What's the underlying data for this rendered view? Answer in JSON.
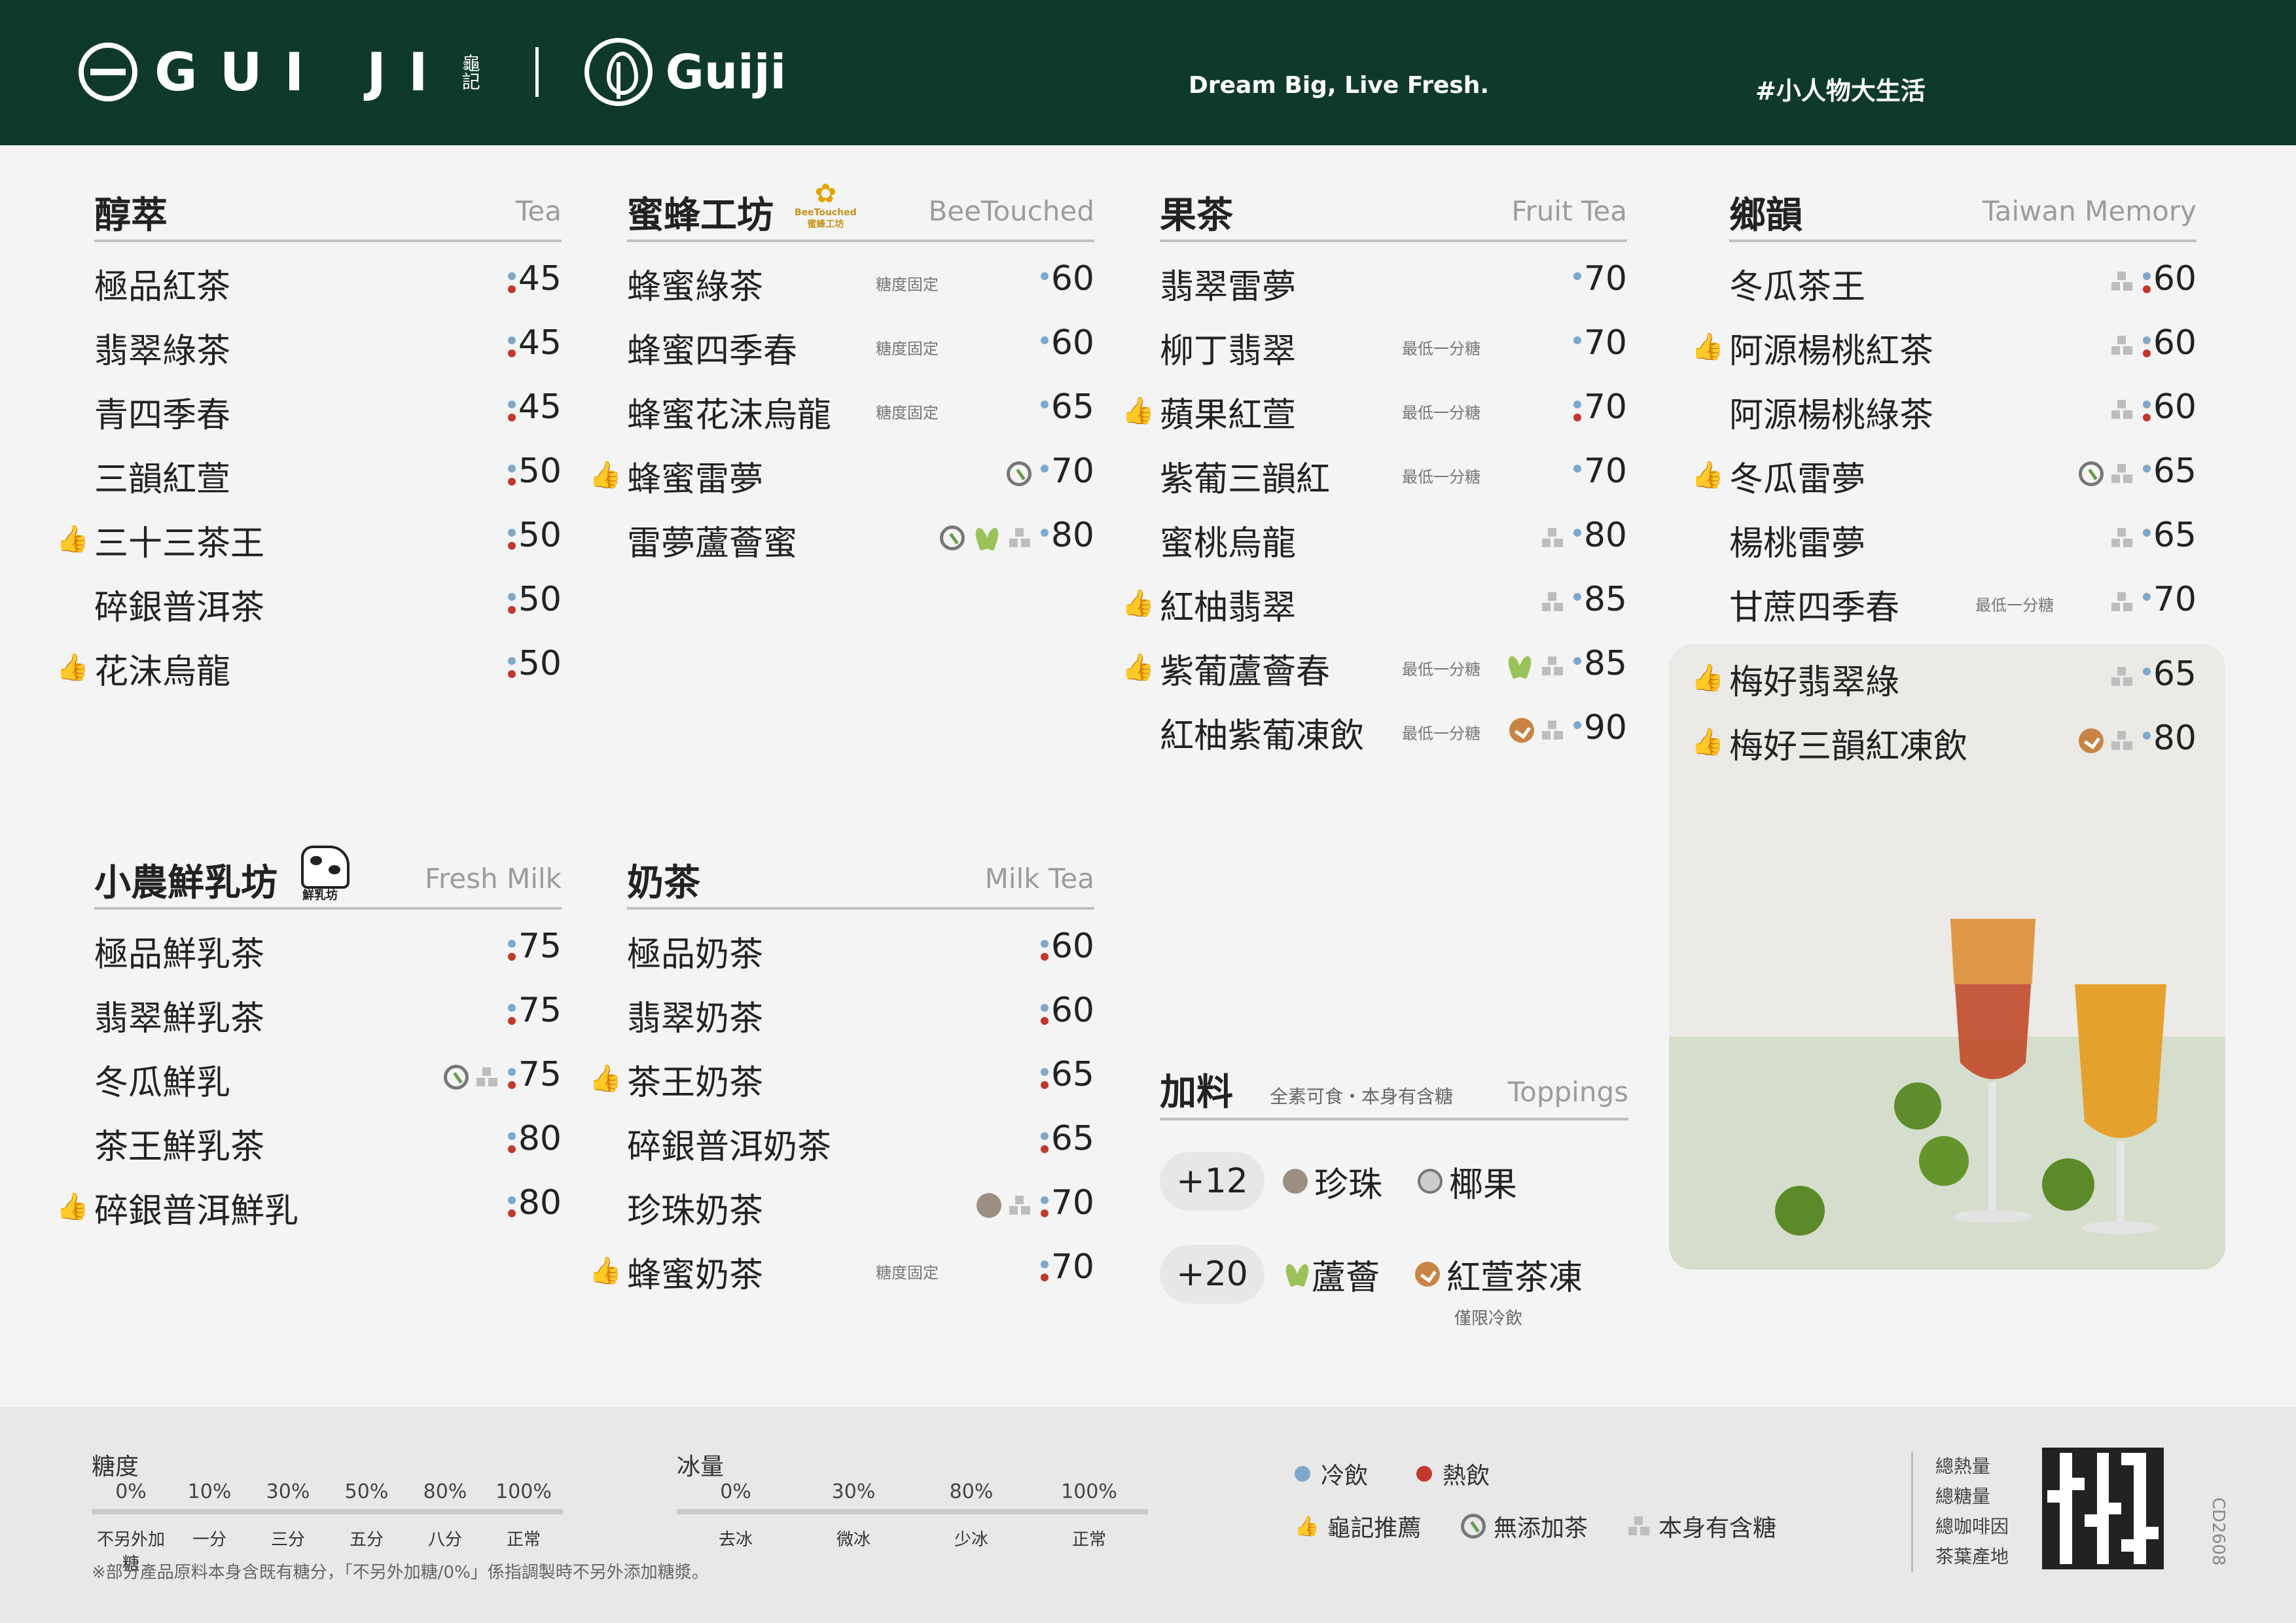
{
  "header": {
    "brand": "GUI JI",
    "brand_sub": "龜記",
    "brand2": "Guiji",
    "slogan": "Dream Big, Live Fresh.",
    "tag": "#小人物大生活"
  },
  "sections": {
    "tea": {
      "zh": "醇萃",
      "en": "Tea",
      "items": [
        {
          "name": "極品紅茶",
          "price": "45"
        },
        {
          "name": "翡翠綠茶",
          "price": "45"
        },
        {
          "name": "青四季春",
          "price": "45"
        },
        {
          "name": "三韻紅萱",
          "price": "50"
        },
        {
          "name": "三十三茶王",
          "price": "50"
        },
        {
          "name": "碎銀普洱茶",
          "price": "50"
        },
        {
          "name": "花沫烏龍",
          "price": "50"
        }
      ]
    },
    "bee": {
      "zh": "蜜蜂工坊",
      "en": "BeeTouched",
      "badge_en": "BeeTouched",
      "badge_zh": "蜜蜂工坊",
      "items": [
        {
          "name": "蜂蜜綠茶",
          "note": "糖度固定",
          "price": "60"
        },
        {
          "name": "蜂蜜四季春",
          "note": "糖度固定",
          "price": "60"
        },
        {
          "name": "蜂蜜花沫烏龍",
          "note": "糖度固定",
          "price": "65"
        },
        {
          "name": "蜂蜜雷夢",
          "price": "70"
        },
        {
          "name": "雷夢蘆薈蜜",
          "price": "80"
        }
      ]
    },
    "fruit": {
      "zh": "果茶",
      "en": "Fruit Tea",
      "items": [
        {
          "name": "翡翠雷夢",
          "price": "70"
        },
        {
          "name": "柳丁翡翠",
          "note": "最低一分糖",
          "price": "70"
        },
        {
          "name": "蘋果紅萱",
          "note": "最低一分糖",
          "price": "70"
        },
        {
          "name": "紫葡三韻紅",
          "note": "最低一分糖",
          "price": "70"
        },
        {
          "name": "蜜桃烏龍",
          "price": "80"
        },
        {
          "name": "紅柚翡翠",
          "price": "85"
        },
        {
          "name": "紫葡蘆薈春",
          "note": "最低一分糖",
          "price": "85"
        },
        {
          "name": "紅柚紫葡凍飲",
          "note": "最低一分糖",
          "price": "90"
        }
      ]
    },
    "memory": {
      "zh": "鄉韻",
      "en": "Taiwan Memory",
      "items": [
        {
          "name": "冬瓜茶王",
          "price": "60"
        },
        {
          "name": "阿源楊桃紅茶",
          "price": "60"
        },
        {
          "name": "阿源楊桃綠茶",
          "price": "60"
        },
        {
          "name": "冬瓜雷夢",
          "price": "65"
        },
        {
          "name": "楊桃雷夢",
          "price": "65"
        },
        {
          "name": "甘蔗四季春",
          "note": "最低一分糖",
          "price": "70"
        },
        {
          "name": "梅好翡翠綠",
          "price": "65"
        },
        {
          "name": "梅好三韻紅凍飲",
          "price": "80"
        }
      ]
    },
    "milk": {
      "zh": "小農鮮乳坊",
      "en": "Fresh Milk",
      "badge": "鮮乳坊",
      "items": [
        {
          "name": "極品鮮乳茶",
          "price": "75"
        },
        {
          "name": "翡翠鮮乳茶",
          "price": "75"
        },
        {
          "name": "冬瓜鮮乳",
          "price": "75"
        },
        {
          "name": "茶王鮮乳茶",
          "price": "80"
        },
        {
          "name": "碎銀普洱鮮乳",
          "price": "80"
        }
      ]
    },
    "milktea": {
      "zh": "奶茶",
      "en": "Milk Tea",
      "items": [
        {
          "name": "極品奶茶",
          "price": "60"
        },
        {
          "name": "翡翠奶茶",
          "price": "60"
        },
        {
          "name": "茶王奶茶",
          "price": "65"
        },
        {
          "name": "碎銀普洱奶茶",
          "price": "65"
        },
        {
          "name": "珍珠奶茶",
          "price": "70"
        },
        {
          "name": "蜂蜜奶茶",
          "note": "糖度固定",
          "price": "70"
        }
      ]
    }
  },
  "toppings": {
    "zh": "加料",
    "note": "全素可食・本身有含糖",
    "en": "Toppings",
    "rows": [
      {
        "price": "+12",
        "items": [
          "珍珠",
          "椰果"
        ]
      },
      {
        "price": "+20",
        "items": [
          "蘆薈",
          "紅萱茶凍"
        ]
      }
    ],
    "only": "僅限冷飲"
  },
  "footer": {
    "sugar_title": "糖度",
    "sugar_pcts": [
      "0%",
      "10%",
      "30%",
      "50%",
      "80%",
      "100%"
    ],
    "sugar_labels": [
      "不另外加糖",
      "一分",
      "三分",
      "五分",
      "八分",
      "正常"
    ],
    "ice_title": "冰量",
    "ice_pcts": [
      "0%",
      "30%",
      "80%",
      "100%"
    ],
    "ice_labels": [
      "去冰",
      "微冰",
      "少冰",
      "正常"
    ],
    "note": "※部分產品原料本身含既有糖分，「不另外加糖/0%」係指調製時不另外添加糖漿。",
    "legend": {
      "cold": "冷飲",
      "hot": "熱飲",
      "rec": "龜記推薦",
      "nosugar": "無添加茶",
      "sugar": "本身有含糖"
    },
    "nutrition": [
      "總熱量",
      "總糖量",
      "總咖啡因",
      "茶葉產地"
    ],
    "code": "CD2608"
  },
  "colors": {
    "header": "#0f3a2a",
    "cold": "#7ea8cb",
    "hot": "#c0392b",
    "accent": "#c88445"
  }
}
